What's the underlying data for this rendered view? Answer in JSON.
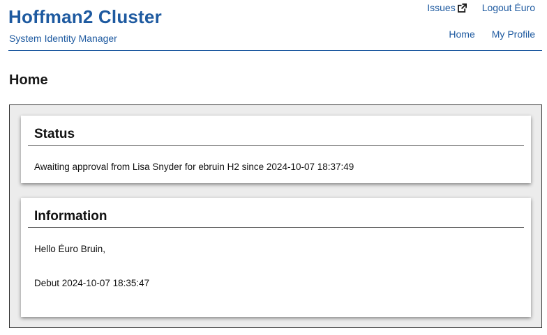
{
  "header": {
    "title": "Hoffman2 Cluster",
    "subtitle": "System Identity Manager",
    "top_links": {
      "issues_label": "Issues",
      "issues_icon": "external-link-icon",
      "logout_label": "Logout Éuro"
    },
    "nav": {
      "home_label": "Home",
      "profile_label": "My Profile"
    },
    "accent_color": "#1e5aa0"
  },
  "main": {
    "page_heading": "Home",
    "status_card": {
      "title": "Status",
      "message": "Awaiting approval from Lisa Snyder for ebruin H2 since 2024-10-07 18:37:49"
    },
    "info_card": {
      "title": "Information",
      "greeting": "Hello Éuro Bruin,",
      "debut": "Debut 2024-10-07 18:35:47"
    }
  }
}
